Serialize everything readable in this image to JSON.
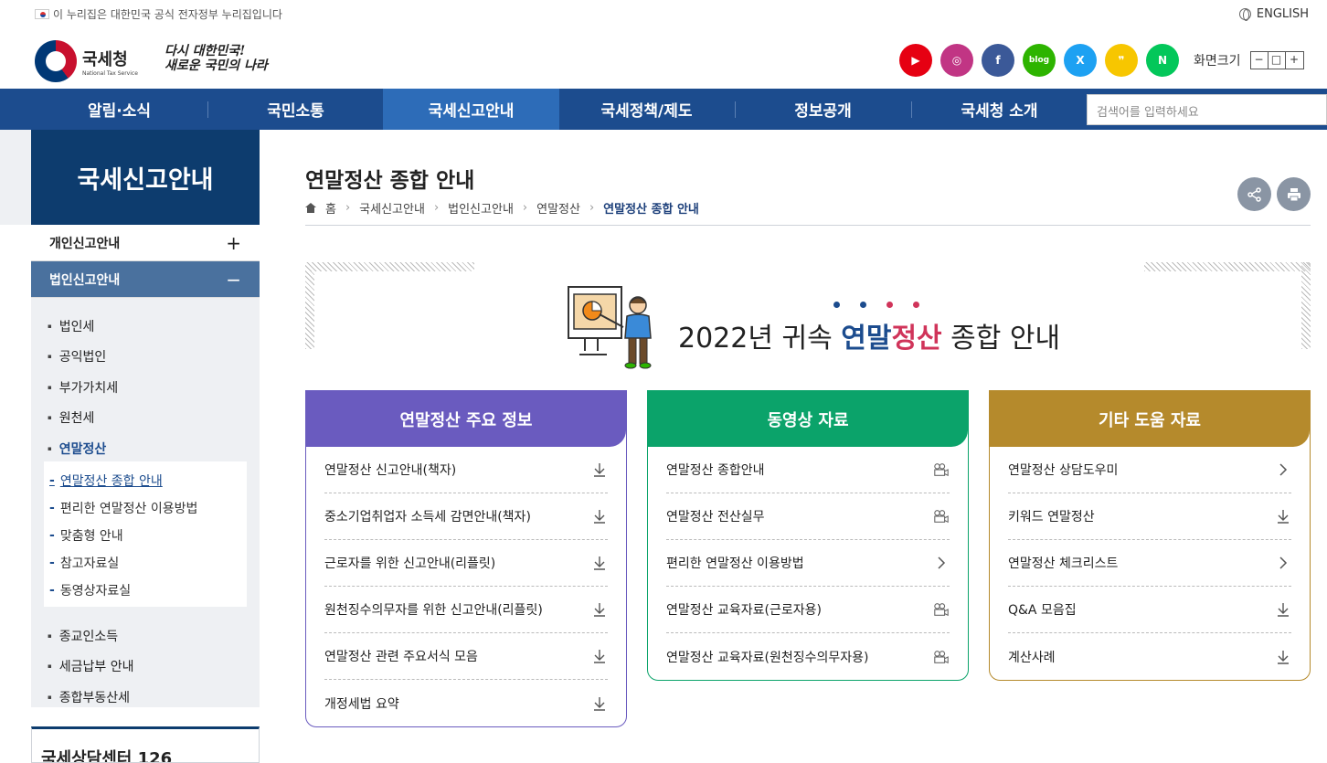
{
  "topbar": {
    "gov_notice": "이 누리집은 대한민국 공식 전자정부 누리집입니다",
    "english": "ENGLISH"
  },
  "header": {
    "logo_name": "국세청",
    "logo_sub": "National Tax Service",
    "slogan_1": "다시 대한민국!",
    "slogan_2": "새로운 국민의 나라",
    "socials": [
      {
        "name": "youtube-icon",
        "label": "▶",
        "color": "#e60012"
      },
      {
        "name": "instagram-icon",
        "label": "◎",
        "color": "#c13584"
      },
      {
        "name": "facebook-icon",
        "label": "f",
        "color": "#3b5998"
      },
      {
        "name": "blog-icon",
        "label": "blog",
        "color": "#2db400"
      },
      {
        "name": "x-icon",
        "label": "X",
        "color": "#1da1f2"
      },
      {
        "name": "kakao-icon",
        "label": "❞",
        "color": "#f7c600"
      },
      {
        "name": "naver-post-icon",
        "label": "N",
        "color": "#03c75a"
      }
    ],
    "font_size_label": "화면크기",
    "font_btns": [
      "−",
      "□",
      "+"
    ]
  },
  "gnb": {
    "items": [
      "알림·소식",
      "국민소통",
      "국세신고안내",
      "국세정책/제도",
      "정보공개",
      "국세청 소개"
    ],
    "search_placeholder": "검색어를 입력하세요"
  },
  "lnb": {
    "title": "국세신고안내",
    "d1": [
      {
        "label": "개인신고안내",
        "sign": "+"
      },
      {
        "label": "법인신고안내",
        "sign": "−"
      }
    ],
    "d2": [
      "법인세",
      "공익법인",
      "부가가치세",
      "원천세",
      "연말정산"
    ],
    "d3": [
      "연말정산 종합 안내",
      "편리한 연말정산 이용방법",
      "맞춤형 안내",
      "참고자료실",
      "동영상자료실"
    ],
    "d2_more": [
      "종교인소득",
      "세금납부 안내",
      "종합부동산세"
    ],
    "center": "국세상담센터 126"
  },
  "page": {
    "title": "연말정산 종합 안내",
    "breadcrumb": [
      "홈",
      "국세신고안내",
      "법인신고안내",
      "연말정산",
      "연말정산 종합 안내"
    ]
  },
  "hero": {
    "prefix": "2022년 귀속 ",
    "blue": "연말",
    "red": "정산",
    "suffix": " 종합 안내"
  },
  "cards": [
    {
      "title": "연말정산 주요 정보",
      "color": "#6a5bbf",
      "rows": [
        {
          "label": "연말정산 신고안내(책자)",
          "icon": "download"
        },
        {
          "label": "중소기업취업자 소득세 감면안내(책자)",
          "icon": "download"
        },
        {
          "label": "근로자를 위한 신고안내(리플릿)",
          "icon": "download"
        },
        {
          "label": "원천징수의무자를 위한 신고안내(리플릿)",
          "icon": "download"
        },
        {
          "label": "연말정산 관련 주요서식 모음",
          "icon": "download"
        },
        {
          "label": "개정세법 요약",
          "icon": "download"
        }
      ]
    },
    {
      "title": "동영상 자료",
      "color": "#0ba36a",
      "rows": [
        {
          "label": "연말정산 종합안내",
          "icon": "video"
        },
        {
          "label": "연말정산 전산실무",
          "icon": "video"
        },
        {
          "label": "편리한 연말정산 이용방법",
          "icon": "link"
        },
        {
          "label": "연말정산 교육자료(근로자용)",
          "icon": "video"
        },
        {
          "label": "연말정산 교육자료(원천징수의무자용)",
          "icon": "video"
        }
      ]
    },
    {
      "title": "기타 도움 자료",
      "color": "#b58a2c",
      "rows": [
        {
          "label": "연말정산 상담도우미",
          "icon": "link"
        },
        {
          "label": "키워드 연말정산",
          "icon": "download"
        },
        {
          "label": "연말정산 체크리스트",
          "icon": "link"
        },
        {
          "label": "Q&A 모음집",
          "icon": "download"
        },
        {
          "label": "계산사례",
          "icon": "download"
        }
      ]
    }
  ]
}
